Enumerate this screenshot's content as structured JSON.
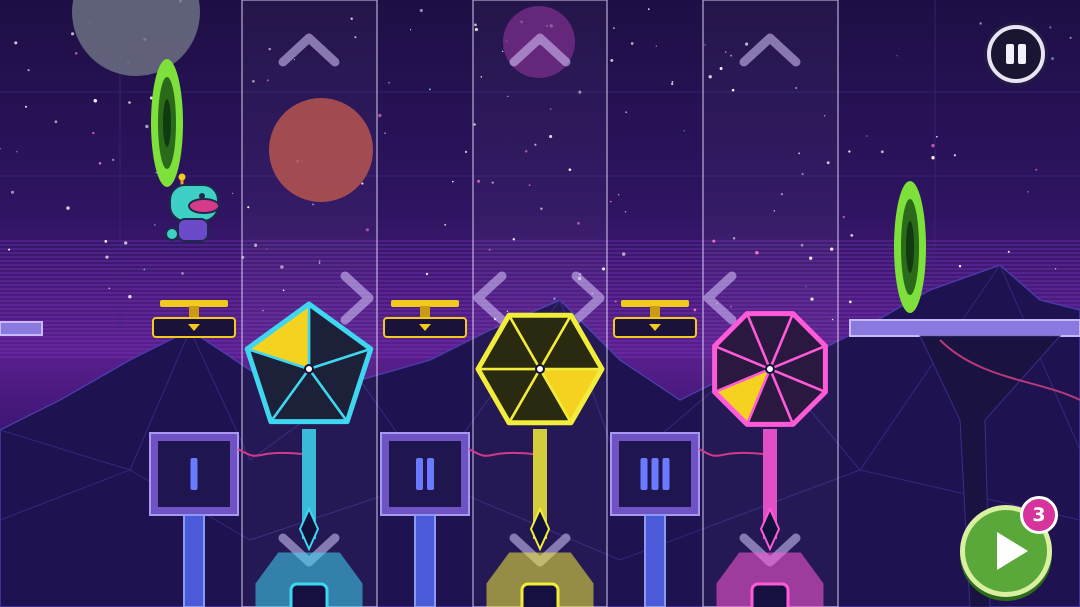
{
  "hud": {
    "pause_icon": "pause-icon",
    "play_icon": "play-icon",
    "moves_remaining": "3"
  },
  "columns": [
    {
      "id": "I",
      "shape": "pentagon",
      "color": "#3fd6f0",
      "has_left_arrow": false,
      "has_right_arrow": true
    },
    {
      "id": "II",
      "shape": "hexagon",
      "color": "#f2ec3a",
      "has_left_arrow": true,
      "has_right_arrow": true
    },
    {
      "id": "III",
      "shape": "octagon",
      "color": "#ff5ad8",
      "has_left_arrow": true,
      "has_right_arrow": false
    }
  ],
  "colors": {
    "sky_top": "#1d0f45",
    "sky_mid": "#5a1f8e",
    "portal": "#8ef03a",
    "selected_wedge": "#f5d21f",
    "lever": "#f2c91e",
    "roman_numeral": "#6a7bff"
  }
}
